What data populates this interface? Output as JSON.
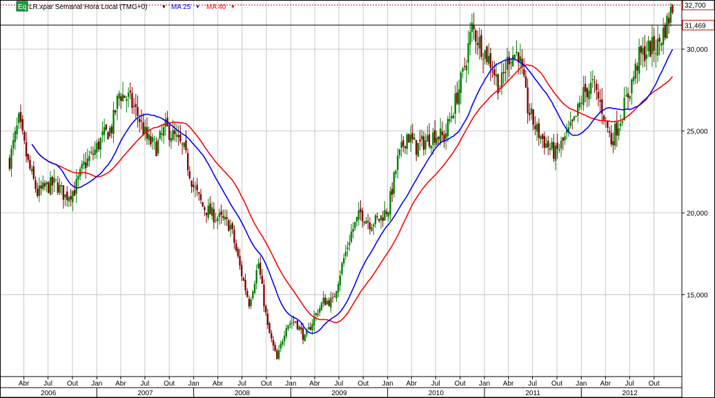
{
  "chart_data": {
    "type": "candlestick",
    "title": "LR.xpar Semanal Hora Local (TMG+0)",
    "legend": [
      {
        "name": "MA 25",
        "color": "#0000ff"
      },
      {
        "name": "MA 40",
        "color": "#ff0000"
      }
    ],
    "legend_badge": "Eq",
    "grid": true,
    "y_axis": {
      "position": "right",
      "range": [
        10000,
        33000
      ],
      "ticks": [
        {
          "value": 15000,
          "label": "15,000"
        },
        {
          "value": 20000,
          "label": "20,000"
        },
        {
          "value": 25000,
          "label": "25,000"
        },
        {
          "value": 30000,
          "label": "30,000"
        }
      ]
    },
    "markers": [
      {
        "value": 32700,
        "label": "32,700",
        "style": "dotted",
        "color": "#cc0000"
      },
      {
        "value": 31469,
        "label": "31,469",
        "style": "solid",
        "color": "#000000"
      }
    ],
    "x_axis": {
      "month_ticks": [
        "Abr",
        "Jul",
        "Out",
        "Jan",
        "Abr",
        "Jul",
        "Out",
        "Jan",
        "Abr",
        "Jul",
        "Out",
        "Jan",
        "Abr",
        "Jul",
        "Out",
        "Jan",
        "Abr",
        "Jul",
        "Out",
        "Jan",
        "Abr",
        "Jul",
        "Out",
        "Jan",
        "Abr",
        "Jul",
        "Out"
      ],
      "years": [
        "2006",
        "2007",
        "2008",
        "2009",
        "2010",
        "2011",
        "2012"
      ]
    },
    "colors": {
      "up": "#008000",
      "down": "#800000",
      "ma25": "#0000ff",
      "ma40": "#ff0000"
    },
    "price_path": [
      {
        "date": "2006-02-06",
        "value": 23200
      },
      {
        "date": "2006-03-13",
        "value": 25600
      },
      {
        "date": "2006-04-17",
        "value": 23000
      },
      {
        "date": "2006-05-22",
        "value": 21200
      },
      {
        "date": "2006-06-26",
        "value": 21600
      },
      {
        "date": "2006-07-31",
        "value": 21800
      },
      {
        "date": "2006-09-04",
        "value": 21000
      },
      {
        "date": "2006-10-09",
        "value": 21400
      },
      {
        "date": "2006-11-13",
        "value": 22900
      },
      {
        "date": "2006-12-18",
        "value": 23600
      },
      {
        "date": "2007-01-22",
        "value": 24600
      },
      {
        "date": "2007-02-26",
        "value": 25200
      },
      {
        "date": "2007-03-26",
        "value": 27300
      },
      {
        "date": "2007-04-30",
        "value": 27000
      },
      {
        "date": "2007-06-04",
        "value": 26000
      },
      {
        "date": "2007-07-09",
        "value": 24500
      },
      {
        "date": "2007-08-13",
        "value": 24000
      },
      {
        "date": "2007-09-17",
        "value": 25200
      },
      {
        "date": "2007-10-22",
        "value": 24600
      },
      {
        "date": "2007-11-26",
        "value": 23800
      },
      {
        "date": "2007-12-31",
        "value": 21600
      },
      {
        "date": "2008-02-04",
        "value": 20400
      },
      {
        "date": "2008-03-10",
        "value": 19900
      },
      {
        "date": "2008-04-14",
        "value": 19600
      },
      {
        "date": "2008-05-19",
        "value": 19200
      },
      {
        "date": "2008-06-23",
        "value": 16700
      },
      {
        "date": "2008-07-28",
        "value": 14500
      },
      {
        "date": "2008-09-01",
        "value": 16900
      },
      {
        "date": "2008-10-06",
        "value": 13000
      },
      {
        "date": "2008-11-10",
        "value": 11000
      },
      {
        "date": "2008-12-15",
        "value": 13200
      },
      {
        "date": "2009-01-19",
        "value": 13400
      },
      {
        "date": "2009-02-23",
        "value": 12300
      },
      {
        "date": "2009-03-30",
        "value": 13600
      },
      {
        "date": "2009-05-04",
        "value": 14600
      },
      {
        "date": "2009-06-08",
        "value": 14600
      },
      {
        "date": "2009-07-13",
        "value": 16800
      },
      {
        "date": "2009-08-17",
        "value": 18800
      },
      {
        "date": "2009-09-21",
        "value": 20000
      },
      {
        "date": "2009-10-26",
        "value": 19400
      },
      {
        "date": "2009-11-30",
        "value": 19600
      },
      {
        "date": "2010-01-04",
        "value": 20300
      },
      {
        "date": "2010-02-08",
        "value": 23200
      },
      {
        "date": "2010-03-15",
        "value": 24800
      },
      {
        "date": "2010-04-19",
        "value": 24000
      },
      {
        "date": "2010-05-24",
        "value": 24400
      },
      {
        "date": "2010-06-28",
        "value": 24800
      },
      {
        "date": "2010-08-02",
        "value": 24600
      },
      {
        "date": "2010-09-06",
        "value": 26400
      },
      {
        "date": "2010-10-11",
        "value": 28400
      },
      {
        "date": "2010-11-15",
        "value": 31300
      },
      {
        "date": "2010-12-20",
        "value": 30200
      },
      {
        "date": "2011-01-24",
        "value": 29200
      },
      {
        "date": "2011-02-28",
        "value": 27600
      },
      {
        "date": "2011-04-04",
        "value": 29600
      },
      {
        "date": "2011-05-09",
        "value": 29800
      },
      {
        "date": "2011-06-13",
        "value": 26400
      },
      {
        "date": "2011-07-18",
        "value": 25000
      },
      {
        "date": "2011-08-22",
        "value": 24200
      },
      {
        "date": "2011-09-26",
        "value": 23600
      },
      {
        "date": "2011-10-31",
        "value": 24500
      },
      {
        "date": "2011-12-05",
        "value": 25500
      },
      {
        "date": "2012-01-09",
        "value": 27300
      },
      {
        "date": "2012-02-13",
        "value": 27800
      },
      {
        "date": "2012-03-19",
        "value": 26400
      },
      {
        "date": "2012-04-23",
        "value": 24400
      },
      {
        "date": "2012-05-28",
        "value": 25800
      },
      {
        "date": "2012-07-02",
        "value": 27600
      },
      {
        "date": "2012-08-06",
        "value": 29500
      },
      {
        "date": "2012-09-10",
        "value": 30000
      },
      {
        "date": "2012-10-15",
        "value": 30200
      },
      {
        "date": "2012-11-19",
        "value": 31600
      },
      {
        "date": "2012-12-10",
        "value": 32600
      }
    ]
  }
}
